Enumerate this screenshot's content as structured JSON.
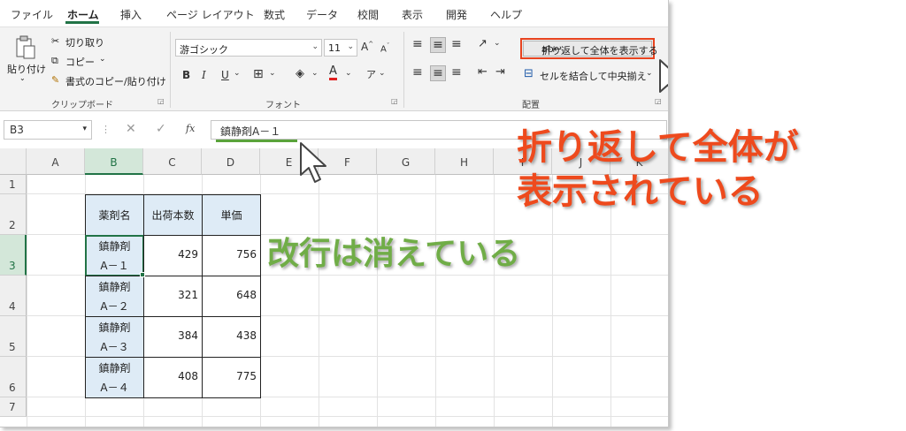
{
  "tabs": [
    "ファイル",
    "ホーム",
    "挿入",
    "ページ レイアウト",
    "数式",
    "データ",
    "校閲",
    "表示",
    "開発",
    "ヘルプ"
  ],
  "clipboard": {
    "paste": "貼り付け",
    "cut": "切り取り",
    "copy": "コピー",
    "format_painter": "書式のコピー/貼り付け",
    "label": "クリップボード"
  },
  "font": {
    "name": "游ゴシック",
    "size": "11",
    "label": "フォント",
    "bold": "B",
    "italic": "I",
    "underline": "U"
  },
  "alignment": {
    "wrap_text": "折り返して全体を表示する",
    "merge_center": "セルを結合して中央揃え",
    "label": "配置"
  },
  "formula_bar": {
    "name_box": "B3",
    "fx": "fx",
    "value": "鎮静剤A－１"
  },
  "columns": [
    "A",
    "B",
    "C",
    "D",
    "E",
    "F",
    "G",
    "H",
    "I",
    "J",
    "K"
  ],
  "rows": [
    "1",
    "2",
    "3",
    "4",
    "5",
    "6",
    "7"
  ],
  "table": {
    "headers": [
      "薬剤名",
      "出荷本数",
      "単価"
    ],
    "rows": [
      {
        "name1": "鎮静剤",
        "name2": "A－１",
        "qty": "429",
        "price": "756"
      },
      {
        "name1": "鎮静剤",
        "name2": "A－２",
        "qty": "321",
        "price": "648"
      },
      {
        "name1": "鎮静剤",
        "name2": "A－３",
        "qty": "384",
        "price": "438"
      },
      {
        "name1": "鎮静剤",
        "name2": "A－４",
        "qty": "408",
        "price": "775"
      }
    ]
  },
  "annotations": {
    "red_line1": "折り返して全体が",
    "red_line2": "表示されている",
    "green": "改行は消えている"
  },
  "colors": {
    "accent_green": "#217346",
    "callout_red": "#ee4a1d",
    "callout_green": "#70ad47",
    "table_fill": "#deebf6"
  }
}
